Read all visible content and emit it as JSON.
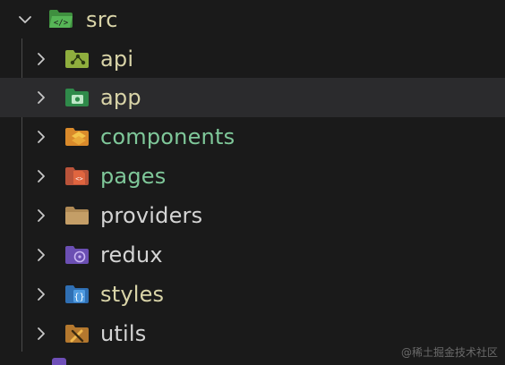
{
  "root": {
    "label": "src",
    "icon": "folder-src-open-icon",
    "expanded": true,
    "color": "#d9d4a8"
  },
  "items": [
    {
      "label": "api",
      "icon": "folder-api-icon",
      "color": "#d9d4a8",
      "selected": false
    },
    {
      "label": "app",
      "icon": "folder-app-icon",
      "color": "#d9d4a8",
      "selected": true
    },
    {
      "label": "components",
      "icon": "folder-components-icon",
      "color": "#7fc89a",
      "selected": false
    },
    {
      "label": "pages",
      "icon": "folder-pages-icon",
      "color": "#7fc89a",
      "selected": false
    },
    {
      "label": "providers",
      "icon": "folder-providers-icon",
      "color": "#d4d4d4",
      "selected": false
    },
    {
      "label": "redux",
      "icon": "folder-redux-icon",
      "color": "#d4d4d4",
      "selected": false
    },
    {
      "label": "styles",
      "icon": "folder-styles-icon",
      "color": "#d9d4a8",
      "selected": false
    },
    {
      "label": "utils",
      "icon": "folder-utils-icon",
      "color": "#d4d4d4",
      "selected": false
    }
  ],
  "watermark": "@稀土掘金技术社区"
}
